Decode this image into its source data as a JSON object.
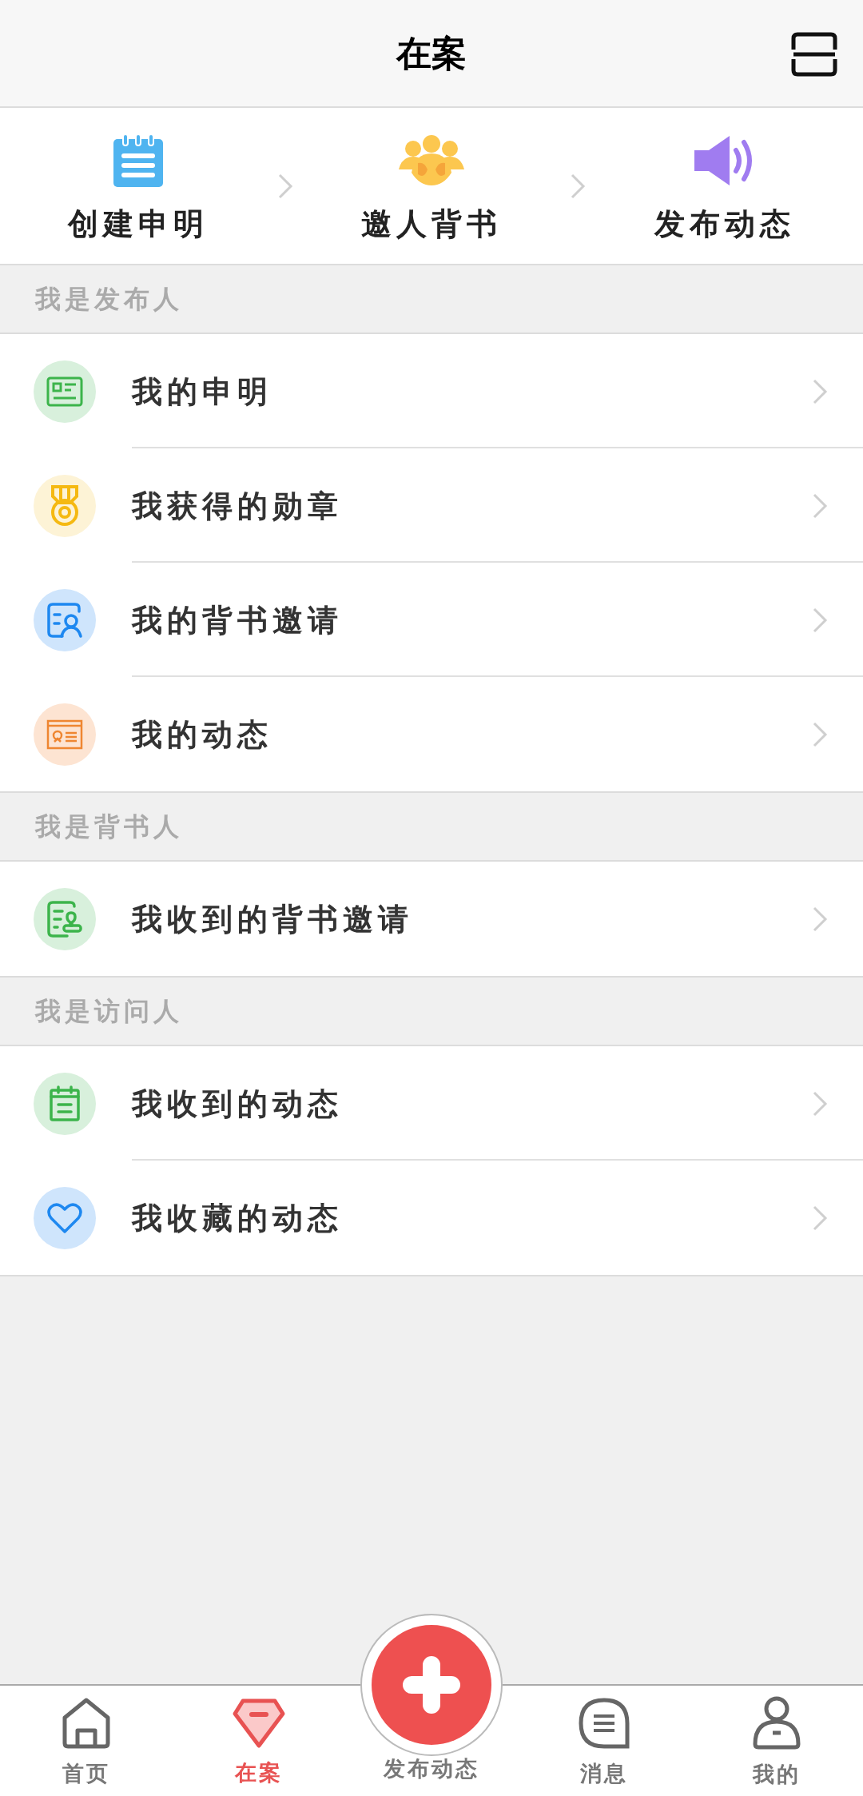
{
  "header": {
    "title": "在案"
  },
  "steps": [
    {
      "label": "创建申明"
    },
    {
      "label": "邀人背书"
    },
    {
      "label": "发布动态"
    }
  ],
  "sections": [
    {
      "title": "我是发布人",
      "items": [
        {
          "label": "我的申明"
        },
        {
          "label": "我获得的勋章"
        },
        {
          "label": "我的背书邀请"
        },
        {
          "label": "我的动态"
        }
      ]
    },
    {
      "title": "我是背书人",
      "items": [
        {
          "label": "我收到的背书邀请"
        }
      ]
    },
    {
      "title": "我是访问人",
      "items": [
        {
          "label": "我收到的动态"
        },
        {
          "label": "我收藏的动态"
        }
      ]
    }
  ],
  "tab_bar": {
    "tabs": [
      {
        "label": "首页",
        "selected": false
      },
      {
        "label": "在案",
        "selected": true
      },
      {
        "label": "发布动态",
        "kind": "fab",
        "selected": false
      },
      {
        "label": "消息",
        "selected": false
      },
      {
        "label": "我的",
        "selected": false
      }
    ]
  }
}
